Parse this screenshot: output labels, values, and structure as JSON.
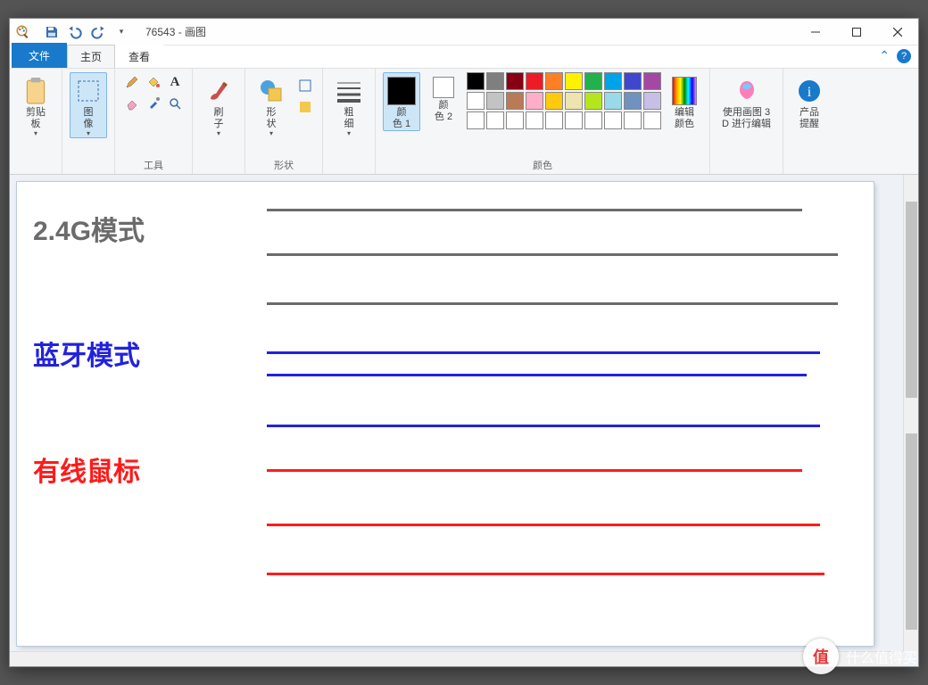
{
  "title": "76543 - 画图",
  "tabs": {
    "file": "文件",
    "home": "主页",
    "view": "查看"
  },
  "groups": {
    "clipboard": {
      "paste": "剪贴\n板",
      "label": ""
    },
    "image": {
      "select": "图\n像",
      "label": ""
    },
    "tools": {
      "label": "工具"
    },
    "brush": {
      "brush": "刷\n子"
    },
    "shapes": {
      "shapes": "形\n状",
      "label": "形状"
    },
    "size": {
      "size": "粗\n细"
    },
    "colors": {
      "c1": "颜\n色 1",
      "c2": "颜\n色 2",
      "edit": "编辑\n颜色",
      "label": "颜色"
    },
    "paint3d": {
      "label": "使用画图 3\nD 进行编辑"
    },
    "alert": {
      "label": "产品\n提醒"
    }
  },
  "palette": {
    "row1": [
      "#000000",
      "#7f7f7f",
      "#880015",
      "#ed1c24",
      "#ff7f27",
      "#fff200",
      "#22b14c",
      "#00a2e8",
      "#3f48cc",
      "#a349a4"
    ],
    "row2": [
      "#ffffff",
      "#c3c3c3",
      "#b97a57",
      "#ffaec9",
      "#ffc90e",
      "#efe4b0",
      "#b5e61d",
      "#99d9ea",
      "#7092be",
      "#c8bfe7"
    ],
    "row3": [
      "#ffffff",
      "#ffffff",
      "#ffffff",
      "#ffffff",
      "#ffffff",
      "#ffffff",
      "#ffffff",
      "#ffffff",
      "#ffffff",
      "#ffffff"
    ]
  },
  "color1": "#000000",
  "color2": "#ffffff",
  "canvas": {
    "labels": {
      "l1": {
        "text": "2.4G模式",
        "color": "#6b6b6b"
      },
      "l2": {
        "text": "蓝牙模式",
        "color": "#2222dd"
      },
      "l3": {
        "text": "有线鼠标",
        "color": "#ff1a1a"
      }
    },
    "lines": {
      "set1_color": "#6b6b6b",
      "set2_color": "#2222dd",
      "set3_color": "#ff1a1a"
    }
  },
  "watermark": "什么值得买"
}
